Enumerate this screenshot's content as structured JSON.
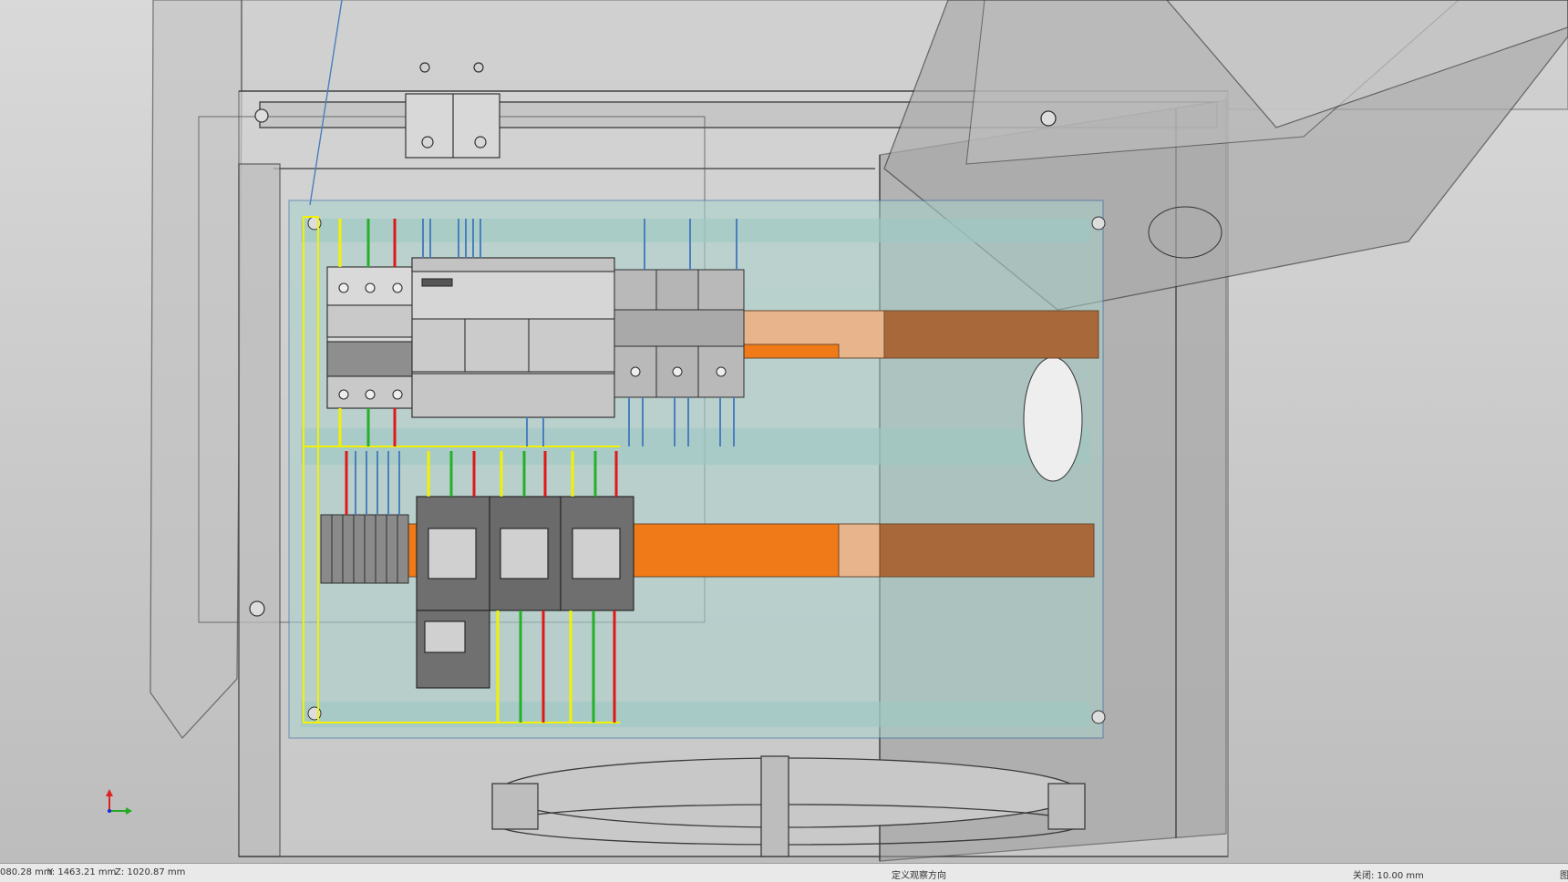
{
  "status_bar": {
    "x_coord": "080.28 mm",
    "y_coord": "Y:  1463.21 mm",
    "z_coord": "Z:  1020.87 mm",
    "view_direction": "定义观察方向",
    "grid": "关闭: 10.00 mm",
    "right_mark": "图"
  },
  "viewport": {
    "model": "electrical-cabinet-3d",
    "colors": {
      "wire_yellow": "#f2f200",
      "wire_green": "#25b125",
      "wire_red": "#e01818",
      "wire_blue": "#4a7fbd",
      "din_rail": "#f07a18",
      "din_rail_dark": "#a9683a",
      "mounting_plate": "#a8d2cc",
      "enclosure_edge": "#3a3a3a"
    },
    "axis_triad_icon": "axis-triad-icon"
  }
}
